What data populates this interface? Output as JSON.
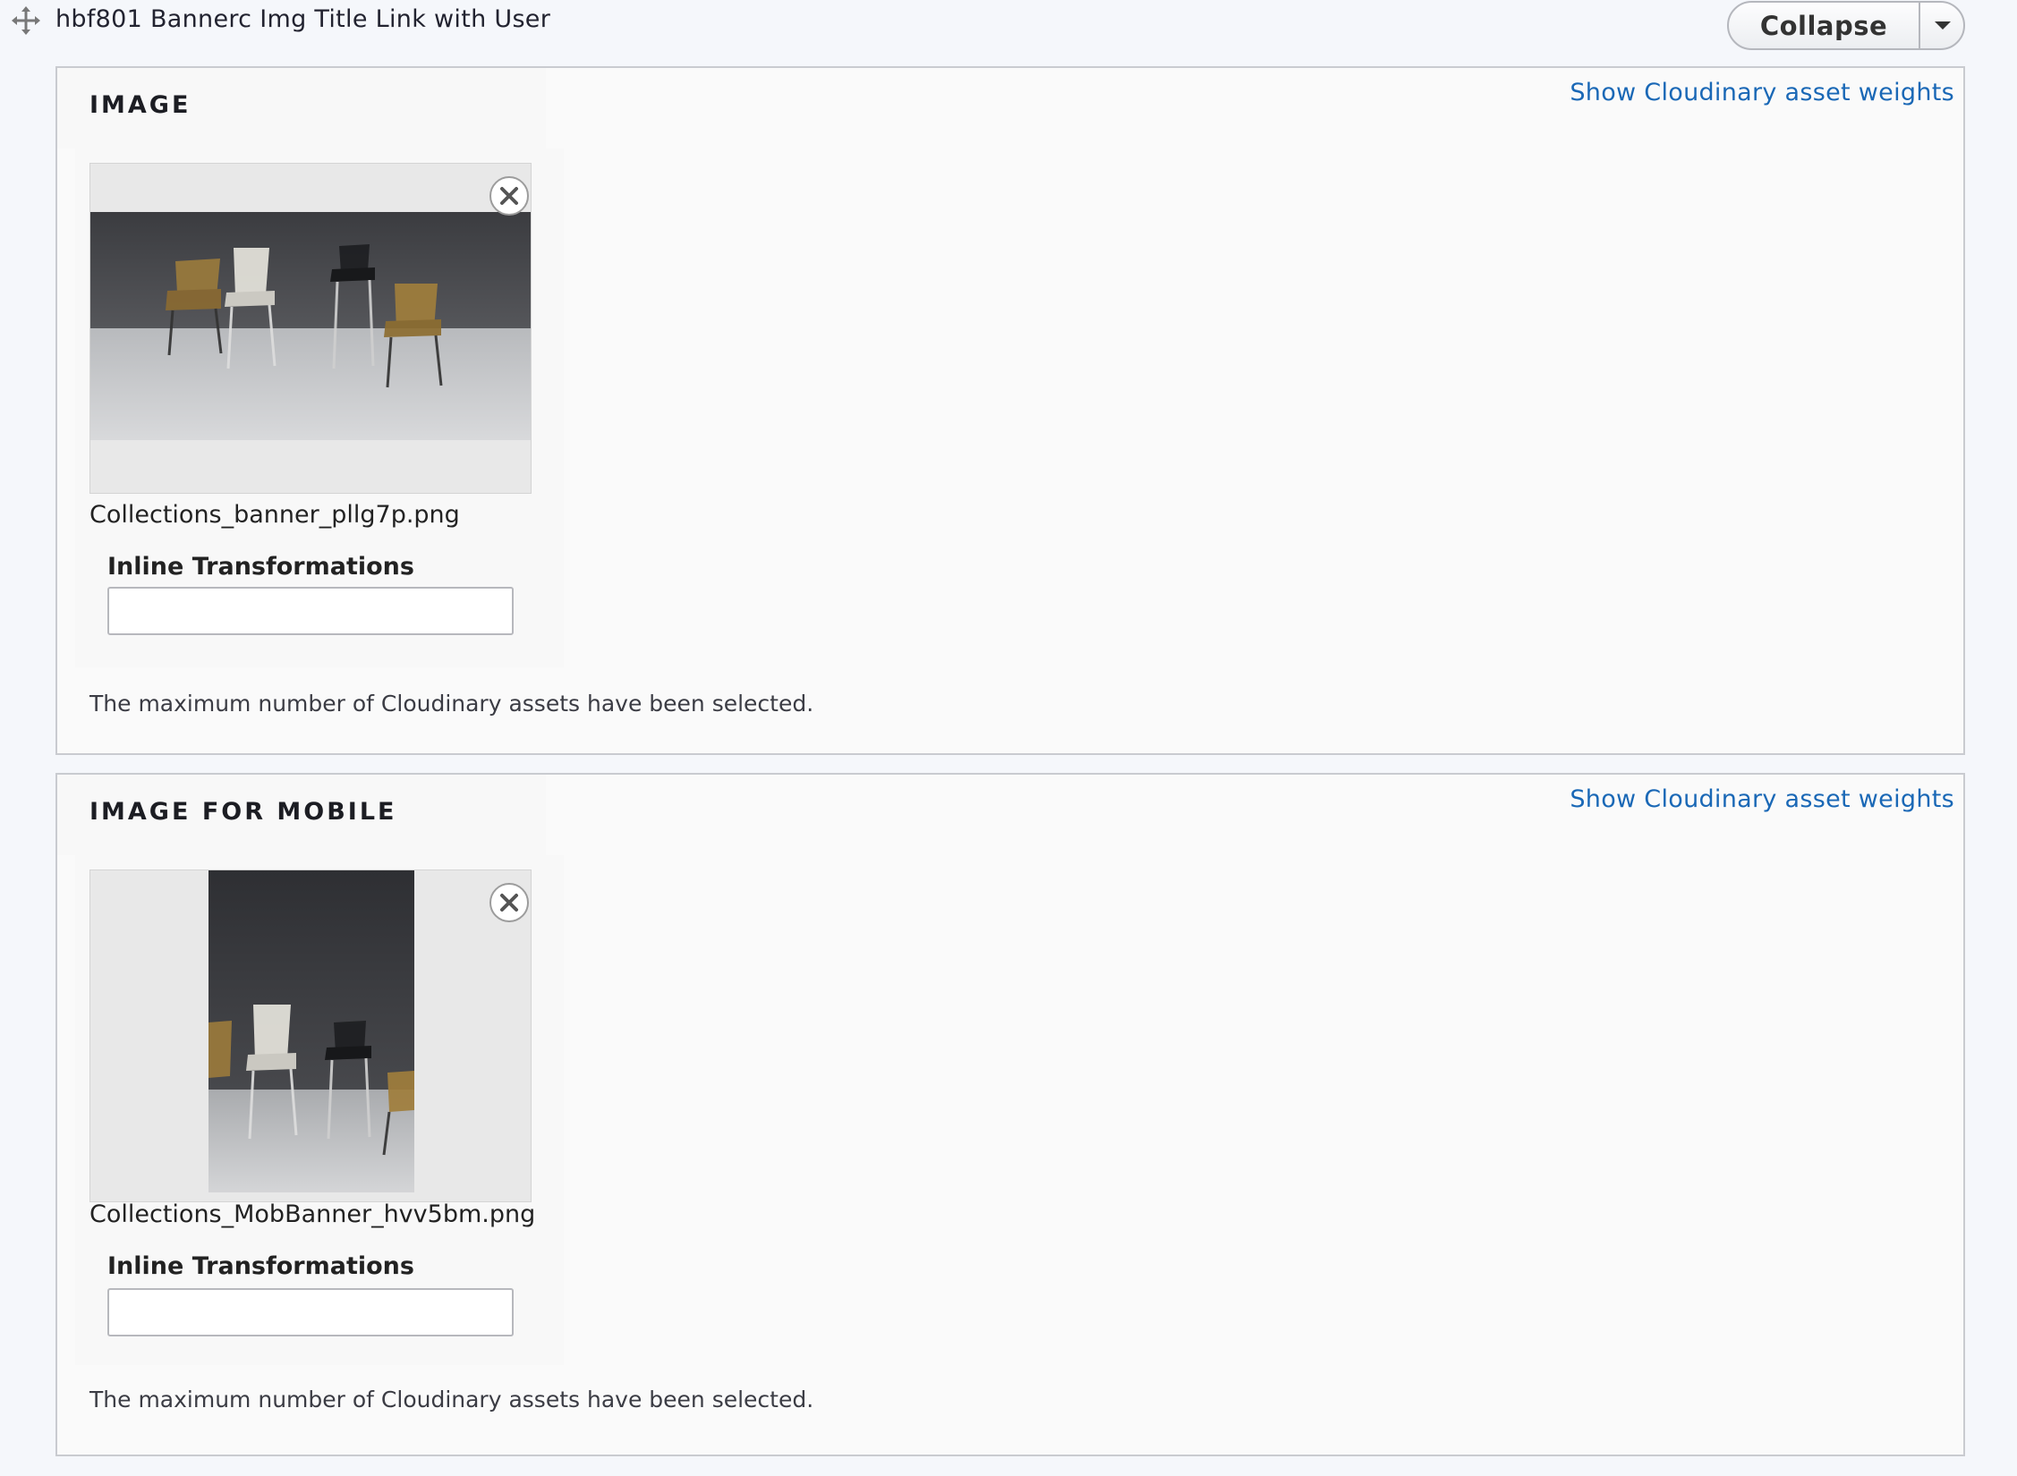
{
  "paragraph": {
    "title": "hbf801 Bannerc Img Title Link with User",
    "collapse_label": "Collapse"
  },
  "fields": [
    {
      "legend": "IMAGE",
      "weights_link": "Show Cloudinary asset weights",
      "filename": "Collections_banner_pllg7p.png",
      "inline_label": "Inline Transformations",
      "inline_value": "",
      "max_message": "The maximum number of Cloudinary assets have been selected."
    },
    {
      "legend": "IMAGE FOR MOBILE",
      "weights_link": "Show Cloudinary asset weights",
      "filename": "Collections_MobBanner_hvv5bm.png",
      "inline_label": "Inline Transformations",
      "inline_value": "",
      "max_message": "The maximum number of Cloudinary assets have been selected."
    }
  ],
  "icons": {
    "drag": "move-arrows-icon",
    "remove": "close-x-icon",
    "dropdown": "caret-down-icon"
  },
  "colors": {
    "link": "#1a68b6",
    "border": "#c9cbd0",
    "panel": "#fafafa"
  }
}
